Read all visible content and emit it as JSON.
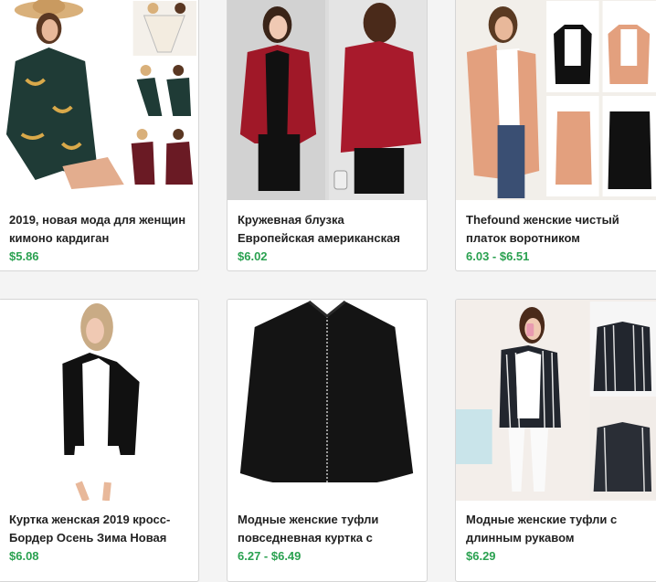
{
  "products": [
    {
      "title": "2019, новая мода для женщин кимоно кардиган",
      "price": "$5.86"
    },
    {
      "title": "Кружевная блузка Европейская американская",
      "price": "$6.02"
    },
    {
      "title": "Thefound женские чистый платок воротником",
      "price": "6.03 - $6.51"
    },
    {
      "title": "Куртка женская 2019 кросс-Бордер Осень Зима Новая",
      "price": "$6.08"
    },
    {
      "title": "Модные женские туфли повседневная куртка с",
      "price": "6.27 - $6.49"
    },
    {
      "title": "Модные женские туфли с длинным рукавом",
      "price": "$6.29"
    }
  ],
  "colors": {
    "price": "#2aa150",
    "title": "#222222",
    "card_border": "#d6d6d6"
  }
}
